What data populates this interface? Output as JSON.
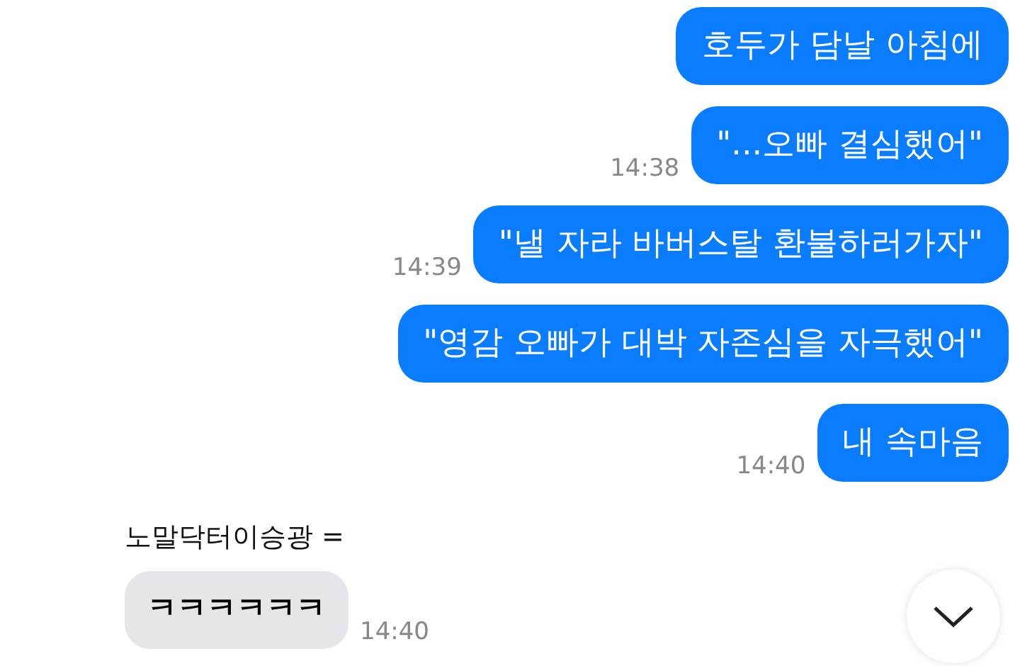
{
  "messages": [
    {
      "kind": "sent",
      "text": "호두가 담날 아침에"
    },
    {
      "kind": "sent",
      "text": "\"...오빠 결심했어\"",
      "time": "14:38"
    },
    {
      "kind": "sent",
      "text": "\"낼 자라 바버스탈 환불하러가자\"",
      "time": "14:39"
    },
    {
      "kind": "sent",
      "text": "\"영감 오빠가 대박 자존심을 자극했어\""
    },
    {
      "kind": "sent",
      "text": "내 속마음",
      "time": "14:40"
    },
    {
      "kind": "sender",
      "text": "노말닥터이승광 ="
    },
    {
      "kind": "received",
      "text": "ㅋㅋㅋㅋㅋㅋ",
      "time": "14:40"
    }
  ]
}
